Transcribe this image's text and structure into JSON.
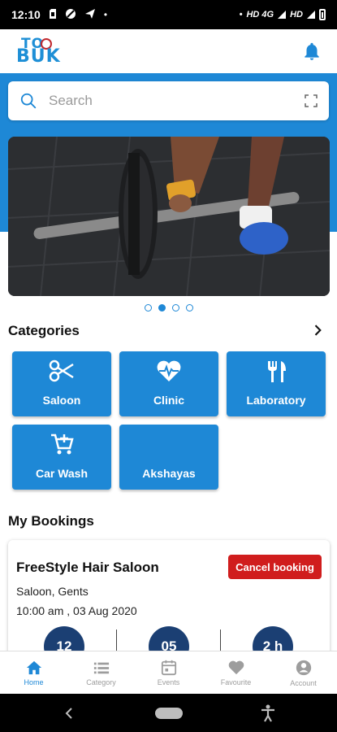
{
  "status_bar": {
    "time": "12:10",
    "network": "HD 4G",
    "network2": "HD"
  },
  "header": {
    "logo_top": "TO",
    "logo_bottom": "BUK"
  },
  "search": {
    "placeholder": "Search"
  },
  "banner": {
    "slides": 4,
    "active_slide": 2
  },
  "categories": {
    "title": "Categories",
    "items": [
      {
        "label": "Saloon",
        "icon": "scissors-icon"
      },
      {
        "label": "Clinic",
        "icon": "heart-pulse-icon"
      },
      {
        "label": "Laboratory",
        "icon": "fork-knife-icon"
      },
      {
        "label": "Car Wash",
        "icon": "cart-plus-icon"
      },
      {
        "label": "Akshayas",
        "icon": "none"
      }
    ]
  },
  "bookings": {
    "title": "My Bookings",
    "items": [
      {
        "name": "FreeStyle Hair Saloon",
        "category": "Saloon, Gents",
        "datetime": "10:00 am , 03 Aug 2020",
        "cancel_label": "Cancel booking",
        "counters": [
          "12",
          "05",
          "2 h"
        ]
      }
    ]
  },
  "bottom_nav": [
    {
      "label": "Home",
      "icon": "home-icon",
      "active": true
    },
    {
      "label": "Category",
      "icon": "list-icon",
      "active": false
    },
    {
      "label": "Events",
      "icon": "calendar-icon",
      "active": false
    },
    {
      "label": "Favourite",
      "icon": "heart-icon",
      "active": false
    },
    {
      "label": "Account",
      "icon": "account-icon",
      "active": false
    }
  ],
  "colors": {
    "primary": "#1e88d6",
    "danger": "#d01d1d",
    "counter": "#1b3f73"
  }
}
